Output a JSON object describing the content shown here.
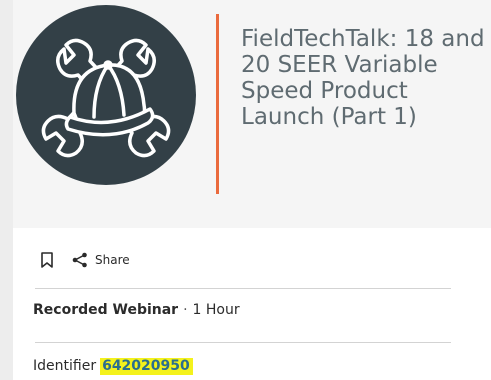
{
  "hero": {
    "logo_icon": "cap-wrench-logo-icon",
    "title": "FieldTechTalk: 18 and 20 SEER Variable Speed Product Launch (Part 1)",
    "accent_color": "#ea6a3d",
    "logo_bg_color": "#334047"
  },
  "actions": {
    "bookmark_icon": "bookmark-icon",
    "share_icon": "share-icon",
    "share_label": "Share"
  },
  "details": {
    "type": "Recorded Webinar",
    "separator": "·",
    "duration": "1 Hour",
    "identifier_label": "Identifier",
    "identifier_value": "642020950",
    "highlight_color": "#f4f21c"
  }
}
